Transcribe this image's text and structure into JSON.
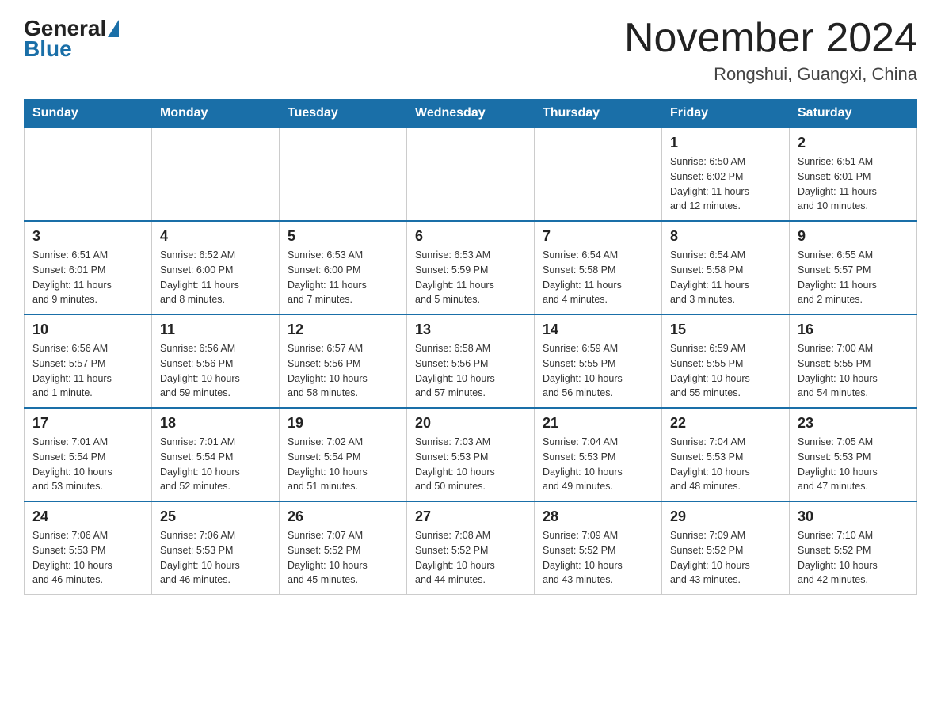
{
  "header": {
    "logo_general": "General",
    "logo_blue": "Blue",
    "title": "November 2024",
    "subtitle": "Rongshui, Guangxi, China"
  },
  "days_of_week": [
    "Sunday",
    "Monday",
    "Tuesday",
    "Wednesday",
    "Thursday",
    "Friday",
    "Saturday"
  ],
  "weeks": [
    {
      "days": [
        {
          "num": "",
          "info": ""
        },
        {
          "num": "",
          "info": ""
        },
        {
          "num": "",
          "info": ""
        },
        {
          "num": "",
          "info": ""
        },
        {
          "num": "",
          "info": ""
        },
        {
          "num": "1",
          "info": "Sunrise: 6:50 AM\nSunset: 6:02 PM\nDaylight: 11 hours\nand 12 minutes."
        },
        {
          "num": "2",
          "info": "Sunrise: 6:51 AM\nSunset: 6:01 PM\nDaylight: 11 hours\nand 10 minutes."
        }
      ]
    },
    {
      "days": [
        {
          "num": "3",
          "info": "Sunrise: 6:51 AM\nSunset: 6:01 PM\nDaylight: 11 hours\nand 9 minutes."
        },
        {
          "num": "4",
          "info": "Sunrise: 6:52 AM\nSunset: 6:00 PM\nDaylight: 11 hours\nand 8 minutes."
        },
        {
          "num": "5",
          "info": "Sunrise: 6:53 AM\nSunset: 6:00 PM\nDaylight: 11 hours\nand 7 minutes."
        },
        {
          "num": "6",
          "info": "Sunrise: 6:53 AM\nSunset: 5:59 PM\nDaylight: 11 hours\nand 5 minutes."
        },
        {
          "num": "7",
          "info": "Sunrise: 6:54 AM\nSunset: 5:58 PM\nDaylight: 11 hours\nand 4 minutes."
        },
        {
          "num": "8",
          "info": "Sunrise: 6:54 AM\nSunset: 5:58 PM\nDaylight: 11 hours\nand 3 minutes."
        },
        {
          "num": "9",
          "info": "Sunrise: 6:55 AM\nSunset: 5:57 PM\nDaylight: 11 hours\nand 2 minutes."
        }
      ]
    },
    {
      "days": [
        {
          "num": "10",
          "info": "Sunrise: 6:56 AM\nSunset: 5:57 PM\nDaylight: 11 hours\nand 1 minute."
        },
        {
          "num": "11",
          "info": "Sunrise: 6:56 AM\nSunset: 5:56 PM\nDaylight: 10 hours\nand 59 minutes."
        },
        {
          "num": "12",
          "info": "Sunrise: 6:57 AM\nSunset: 5:56 PM\nDaylight: 10 hours\nand 58 minutes."
        },
        {
          "num": "13",
          "info": "Sunrise: 6:58 AM\nSunset: 5:56 PM\nDaylight: 10 hours\nand 57 minutes."
        },
        {
          "num": "14",
          "info": "Sunrise: 6:59 AM\nSunset: 5:55 PM\nDaylight: 10 hours\nand 56 minutes."
        },
        {
          "num": "15",
          "info": "Sunrise: 6:59 AM\nSunset: 5:55 PM\nDaylight: 10 hours\nand 55 minutes."
        },
        {
          "num": "16",
          "info": "Sunrise: 7:00 AM\nSunset: 5:55 PM\nDaylight: 10 hours\nand 54 minutes."
        }
      ]
    },
    {
      "days": [
        {
          "num": "17",
          "info": "Sunrise: 7:01 AM\nSunset: 5:54 PM\nDaylight: 10 hours\nand 53 minutes."
        },
        {
          "num": "18",
          "info": "Sunrise: 7:01 AM\nSunset: 5:54 PM\nDaylight: 10 hours\nand 52 minutes."
        },
        {
          "num": "19",
          "info": "Sunrise: 7:02 AM\nSunset: 5:54 PM\nDaylight: 10 hours\nand 51 minutes."
        },
        {
          "num": "20",
          "info": "Sunrise: 7:03 AM\nSunset: 5:53 PM\nDaylight: 10 hours\nand 50 minutes."
        },
        {
          "num": "21",
          "info": "Sunrise: 7:04 AM\nSunset: 5:53 PM\nDaylight: 10 hours\nand 49 minutes."
        },
        {
          "num": "22",
          "info": "Sunrise: 7:04 AM\nSunset: 5:53 PM\nDaylight: 10 hours\nand 48 minutes."
        },
        {
          "num": "23",
          "info": "Sunrise: 7:05 AM\nSunset: 5:53 PM\nDaylight: 10 hours\nand 47 minutes."
        }
      ]
    },
    {
      "days": [
        {
          "num": "24",
          "info": "Sunrise: 7:06 AM\nSunset: 5:53 PM\nDaylight: 10 hours\nand 46 minutes."
        },
        {
          "num": "25",
          "info": "Sunrise: 7:06 AM\nSunset: 5:53 PM\nDaylight: 10 hours\nand 46 minutes."
        },
        {
          "num": "26",
          "info": "Sunrise: 7:07 AM\nSunset: 5:52 PM\nDaylight: 10 hours\nand 45 minutes."
        },
        {
          "num": "27",
          "info": "Sunrise: 7:08 AM\nSunset: 5:52 PM\nDaylight: 10 hours\nand 44 minutes."
        },
        {
          "num": "28",
          "info": "Sunrise: 7:09 AM\nSunset: 5:52 PM\nDaylight: 10 hours\nand 43 minutes."
        },
        {
          "num": "29",
          "info": "Sunrise: 7:09 AM\nSunset: 5:52 PM\nDaylight: 10 hours\nand 43 minutes."
        },
        {
          "num": "30",
          "info": "Sunrise: 7:10 AM\nSunset: 5:52 PM\nDaylight: 10 hours\nand 42 minutes."
        }
      ]
    }
  ]
}
